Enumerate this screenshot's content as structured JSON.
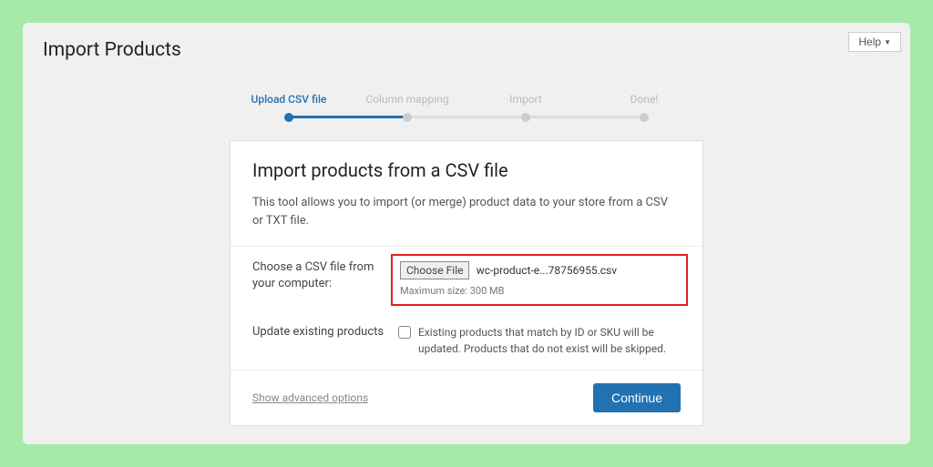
{
  "header": {
    "page_title": "Import Products",
    "help_label": "Help"
  },
  "stepper": {
    "steps": [
      {
        "label": "Upload CSV file",
        "active": true
      },
      {
        "label": "Column mapping",
        "active": false
      },
      {
        "label": "Import",
        "active": false
      },
      {
        "label": "Done!",
        "active": false
      }
    ]
  },
  "card": {
    "title": "Import products from a CSV file",
    "description": "This tool allows you to import (or merge) product data to your store from a CSV or TXT file.",
    "file_row": {
      "label": "Choose a CSV file from your computer:",
      "button": "Choose File",
      "filename": "wc-product-e...78756955.csv",
      "hint": "Maximum size: 300 MB"
    },
    "update_row": {
      "label": "Update existing products",
      "checkbox_text": "Existing products that match by ID or SKU will be updated. Products that do not exist will be skipped."
    },
    "footer": {
      "advanced_link": "Show advanced options",
      "continue": "Continue"
    }
  }
}
